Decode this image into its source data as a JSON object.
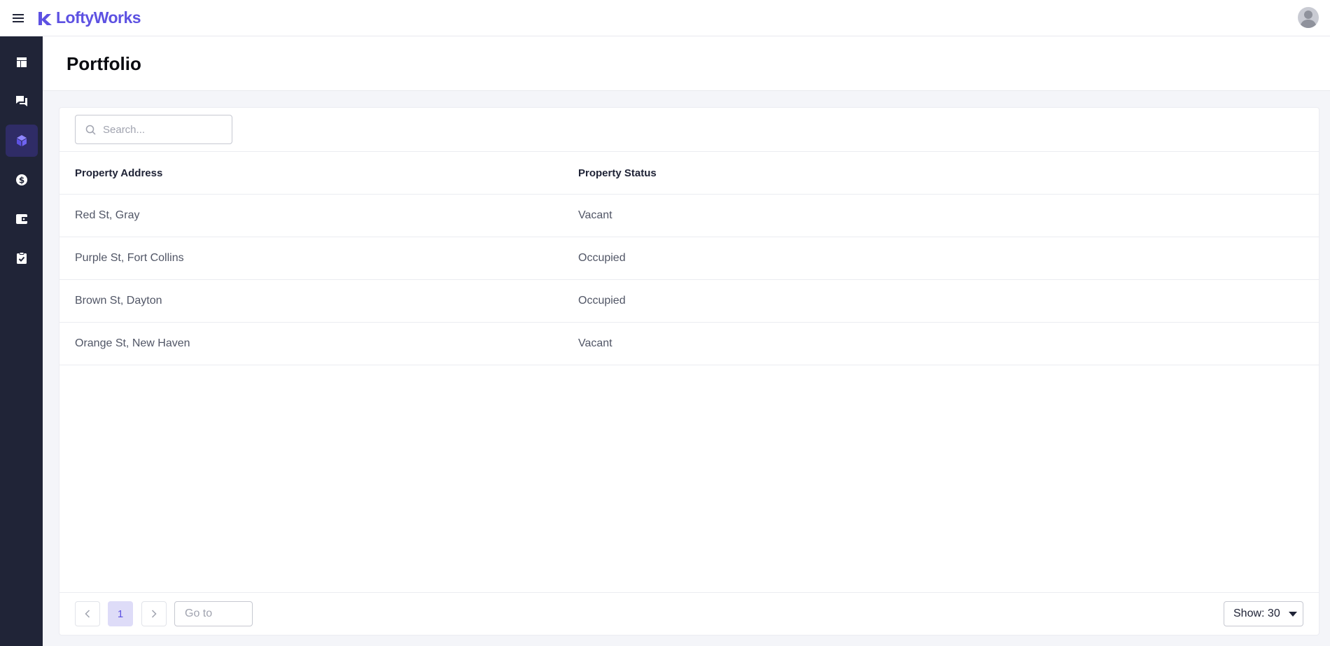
{
  "app": {
    "brand": "LoftyWorks",
    "accent_color": "#5d51e2",
    "sidebar_color": "#202437"
  },
  "sidebar": {
    "items": [
      {
        "icon": "dashboard-icon",
        "active": false
      },
      {
        "icon": "chat-icon",
        "active": false
      },
      {
        "icon": "cube-icon",
        "active": true
      },
      {
        "icon": "dollar-icon",
        "active": false
      },
      {
        "icon": "wallet-icon",
        "active": false
      },
      {
        "icon": "clipboard-check-icon",
        "active": false
      }
    ]
  },
  "page": {
    "title": "Portfolio"
  },
  "search": {
    "placeholder": "Search..."
  },
  "table": {
    "columns": [
      "Property Address",
      "Property Status"
    ],
    "rows": [
      {
        "address": "Red St, Gray",
        "status": "Vacant"
      },
      {
        "address": "Purple St, Fort Collins",
        "status": "Occupied"
      },
      {
        "address": "Brown St, Dayton",
        "status": "Occupied"
      },
      {
        "address": "Orange St, New Haven",
        "status": "Vacant"
      }
    ]
  },
  "pagination": {
    "current_page": "1",
    "goto_placeholder": "Go to",
    "show_label": "Show: 30"
  }
}
